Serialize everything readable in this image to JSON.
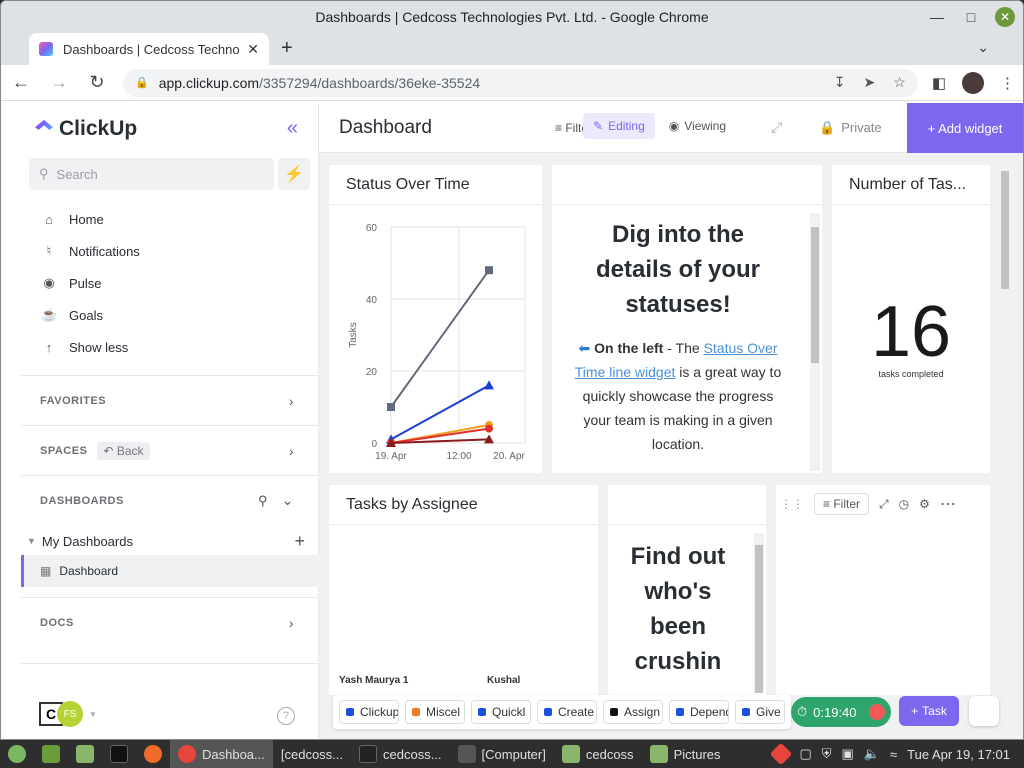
{
  "browser": {
    "window_title": "Dashboards | Cedcoss Technologies Pvt. Ltd. - Google Chrome",
    "tab_title": "Dashboards | Cedcoss Techno",
    "url_host": "app.clickup.com",
    "url_path": "/3357294/dashboards/36eke-35524"
  },
  "sidebar": {
    "brand": "ClickUp",
    "search_placeholder": "Search",
    "nav": [
      "Home",
      "Notifications",
      "Pulse",
      "Goals",
      "Show less"
    ],
    "favorites": "FAVORITES",
    "spaces": "SPACES",
    "back": "Back",
    "dashboards": "DASHBOARDS",
    "my_dashboards": "My Dashboards",
    "dashboard_item": "Dashboard",
    "docs": "DOCS",
    "avatar_initial": "C",
    "avatar2_initials": "FS"
  },
  "header": {
    "title": "Dashboard",
    "filter": "Filter",
    "editing": "Editing",
    "viewing": "Viewing",
    "private": "Private",
    "add_widget": "+ Add widget"
  },
  "widgets": {
    "status_over_time": {
      "title": "Status Over Time",
      "ylabel": "Tasks"
    },
    "dig": {
      "heading": "Dig into the details of your statuses!",
      "lead_bold": "On the left",
      "lead_pre": " - The ",
      "link": "Status Over Time line widget",
      "rest": " is a great way to quickly showcase the progress your team is making in a given location."
    },
    "number": {
      "title": "Number of Tas...",
      "value": "16",
      "caption": "tasks completed"
    },
    "assignee": {
      "title": "Tasks by Assignee",
      "label1": "Yash Maurya 1",
      "label2": "Kushal"
    },
    "find_out": {
      "heading": "Find out who's been crushin"
    },
    "toolbar": {
      "filter": "Filter"
    }
  },
  "bottom": {
    "pills": [
      {
        "label": "Clickup",
        "color": "#1b4fe0"
      },
      {
        "label": "Miscel",
        "color": "#f07b22"
      },
      {
        "label": "Quickl",
        "color": "#1b4fe0"
      },
      {
        "label": "Create",
        "color": "#1b4fe0"
      },
      {
        "label": "Assign",
        "color": "#111111"
      },
      {
        "label": "Depend",
        "color": "#1b4fe0"
      },
      {
        "label": "Give it",
        "color": "#1b4fe0"
      }
    ],
    "timer": "0:19:40",
    "task_btn": "Task"
  },
  "taskbar": {
    "items": [
      "Dashboa...",
      "[cedcoss...",
      "cedcoss...",
      "[Computer]",
      "cedcoss",
      "Pictures"
    ],
    "clock": "Tue Apr 19, 17:01"
  },
  "chart_data": {
    "type": "line",
    "title": "Status Over Time",
    "ylabel": "Tasks",
    "x_ticks": [
      "19. Apr",
      "12:00",
      "20. Apr"
    ],
    "ylim": [
      0,
      60
    ],
    "y_ticks": [
      0,
      20,
      40,
      60
    ],
    "series": [
      {
        "color": "#5f6b7a",
        "x": [
          0,
          1
        ],
        "values": [
          10,
          48
        ]
      },
      {
        "color": "#1b3fd6",
        "x": [
          0,
          1
        ],
        "values": [
          1,
          16
        ]
      },
      {
        "color": "#f0a020",
        "x": [
          0,
          1
        ],
        "values": [
          0,
          5
        ]
      },
      {
        "color": "#e23030",
        "x": [
          0,
          1
        ],
        "values": [
          0,
          4
        ]
      },
      {
        "color": "#8b1a1a",
        "x": [
          0,
          1
        ],
        "values": [
          0,
          1
        ]
      }
    ]
  }
}
